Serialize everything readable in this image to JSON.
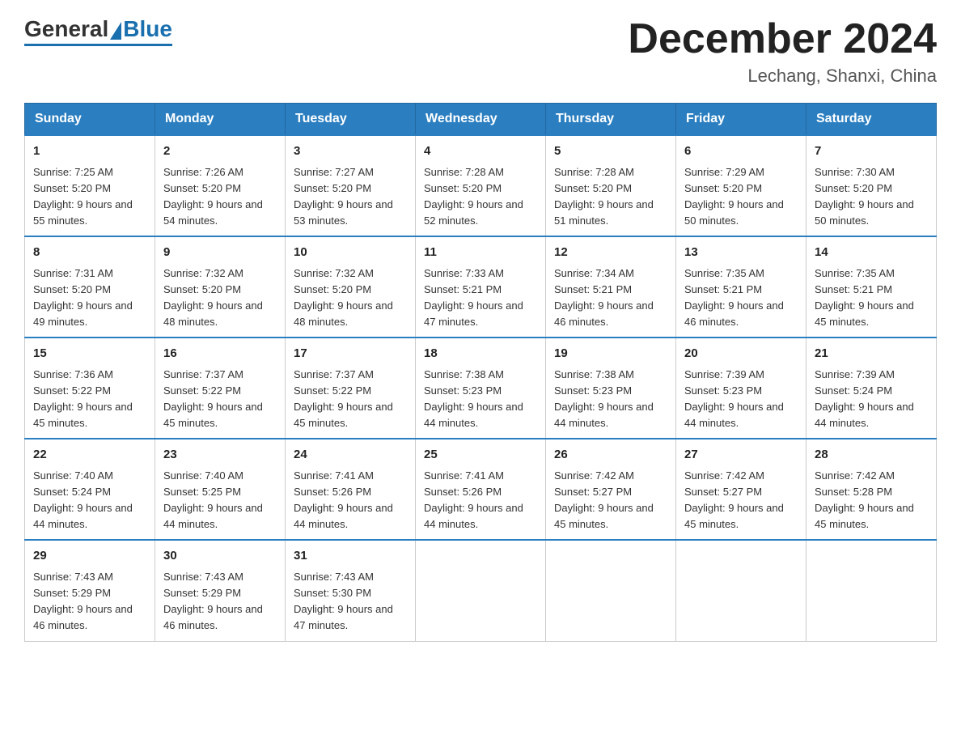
{
  "header": {
    "logo_general": "General",
    "logo_blue": "Blue",
    "month_title": "December 2024",
    "location": "Lechang, Shanxi, China"
  },
  "weekdays": [
    "Sunday",
    "Monday",
    "Tuesday",
    "Wednesday",
    "Thursday",
    "Friday",
    "Saturday"
  ],
  "weeks": [
    [
      {
        "day": "1",
        "sunrise": "7:25 AM",
        "sunset": "5:20 PM",
        "daylight": "9 hours and 55 minutes."
      },
      {
        "day": "2",
        "sunrise": "7:26 AM",
        "sunset": "5:20 PM",
        "daylight": "9 hours and 54 minutes."
      },
      {
        "day": "3",
        "sunrise": "7:27 AM",
        "sunset": "5:20 PM",
        "daylight": "9 hours and 53 minutes."
      },
      {
        "day": "4",
        "sunrise": "7:28 AM",
        "sunset": "5:20 PM",
        "daylight": "9 hours and 52 minutes."
      },
      {
        "day": "5",
        "sunrise": "7:28 AM",
        "sunset": "5:20 PM",
        "daylight": "9 hours and 51 minutes."
      },
      {
        "day": "6",
        "sunrise": "7:29 AM",
        "sunset": "5:20 PM",
        "daylight": "9 hours and 50 minutes."
      },
      {
        "day": "7",
        "sunrise": "7:30 AM",
        "sunset": "5:20 PM",
        "daylight": "9 hours and 50 minutes."
      }
    ],
    [
      {
        "day": "8",
        "sunrise": "7:31 AM",
        "sunset": "5:20 PM",
        "daylight": "9 hours and 49 minutes."
      },
      {
        "day": "9",
        "sunrise": "7:32 AM",
        "sunset": "5:20 PM",
        "daylight": "9 hours and 48 minutes."
      },
      {
        "day": "10",
        "sunrise": "7:32 AM",
        "sunset": "5:20 PM",
        "daylight": "9 hours and 48 minutes."
      },
      {
        "day": "11",
        "sunrise": "7:33 AM",
        "sunset": "5:21 PM",
        "daylight": "9 hours and 47 minutes."
      },
      {
        "day": "12",
        "sunrise": "7:34 AM",
        "sunset": "5:21 PM",
        "daylight": "9 hours and 46 minutes."
      },
      {
        "day": "13",
        "sunrise": "7:35 AM",
        "sunset": "5:21 PM",
        "daylight": "9 hours and 46 minutes."
      },
      {
        "day": "14",
        "sunrise": "7:35 AM",
        "sunset": "5:21 PM",
        "daylight": "9 hours and 45 minutes."
      }
    ],
    [
      {
        "day": "15",
        "sunrise": "7:36 AM",
        "sunset": "5:22 PM",
        "daylight": "9 hours and 45 minutes."
      },
      {
        "day": "16",
        "sunrise": "7:37 AM",
        "sunset": "5:22 PM",
        "daylight": "9 hours and 45 minutes."
      },
      {
        "day": "17",
        "sunrise": "7:37 AM",
        "sunset": "5:22 PM",
        "daylight": "9 hours and 45 minutes."
      },
      {
        "day": "18",
        "sunrise": "7:38 AM",
        "sunset": "5:23 PM",
        "daylight": "9 hours and 44 minutes."
      },
      {
        "day": "19",
        "sunrise": "7:38 AM",
        "sunset": "5:23 PM",
        "daylight": "9 hours and 44 minutes."
      },
      {
        "day": "20",
        "sunrise": "7:39 AM",
        "sunset": "5:23 PM",
        "daylight": "9 hours and 44 minutes."
      },
      {
        "day": "21",
        "sunrise": "7:39 AM",
        "sunset": "5:24 PM",
        "daylight": "9 hours and 44 minutes."
      }
    ],
    [
      {
        "day": "22",
        "sunrise": "7:40 AM",
        "sunset": "5:24 PM",
        "daylight": "9 hours and 44 minutes."
      },
      {
        "day": "23",
        "sunrise": "7:40 AM",
        "sunset": "5:25 PM",
        "daylight": "9 hours and 44 minutes."
      },
      {
        "day": "24",
        "sunrise": "7:41 AM",
        "sunset": "5:26 PM",
        "daylight": "9 hours and 44 minutes."
      },
      {
        "day": "25",
        "sunrise": "7:41 AM",
        "sunset": "5:26 PM",
        "daylight": "9 hours and 44 minutes."
      },
      {
        "day": "26",
        "sunrise": "7:42 AM",
        "sunset": "5:27 PM",
        "daylight": "9 hours and 45 minutes."
      },
      {
        "day": "27",
        "sunrise": "7:42 AM",
        "sunset": "5:27 PM",
        "daylight": "9 hours and 45 minutes."
      },
      {
        "day": "28",
        "sunrise": "7:42 AM",
        "sunset": "5:28 PM",
        "daylight": "9 hours and 45 minutes."
      }
    ],
    [
      {
        "day": "29",
        "sunrise": "7:43 AM",
        "sunset": "5:29 PM",
        "daylight": "9 hours and 46 minutes."
      },
      {
        "day": "30",
        "sunrise": "7:43 AM",
        "sunset": "5:29 PM",
        "daylight": "9 hours and 46 minutes."
      },
      {
        "day": "31",
        "sunrise": "7:43 AM",
        "sunset": "5:30 PM",
        "daylight": "9 hours and 47 minutes."
      },
      null,
      null,
      null,
      null
    ]
  ]
}
